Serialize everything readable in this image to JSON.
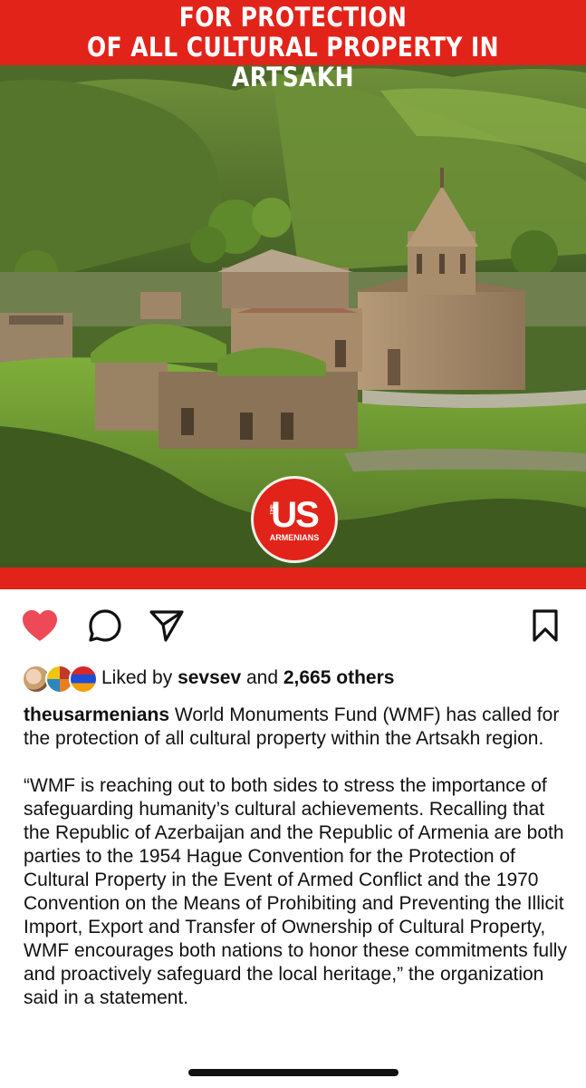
{
  "post": {
    "banner_title": "WORLD MONUMENTS FUND CALLS FOR PROTECTION\nOF ALL CULTURAL PROPERTY IN ARTSAKH",
    "logo": {
      "main": "US",
      "sub": "ARMENIANS",
      "prefix": "THE"
    },
    "accent_color": "#e2231a"
  },
  "actions": {
    "liked": true,
    "like_color": "#ed4956",
    "icons": [
      "heart-icon",
      "comment-icon",
      "share-icon",
      "bookmark-icon"
    ]
  },
  "likes": {
    "prefix": "Liked by ",
    "user": "sevsev",
    "middle": " and ",
    "count": "2,665 others"
  },
  "caption": {
    "username": "theusarmenians",
    "para1": " World Monuments Fund (WMF) has called for the protection of all cultural property within the Artsakh region.",
    "para2": "“WMF is reaching out to both sides to stress the importance of safeguarding humanity’s cultural achievements. Recalling that the Republic of Azerbaijan and the Republic of Armenia are both parties to the 1954 Hague Convention for the Protection of Cultural Property in the Event of Armed Conflict and the 1970 Convention on the Means of Prohibiting and Preventing the Illicit Import, Export and Transfer of Ownership of Cultural Property, WMF encourages both nations to honor these commitments fully and proactively safeguard the local heritage,” the organization said in a statement."
  }
}
